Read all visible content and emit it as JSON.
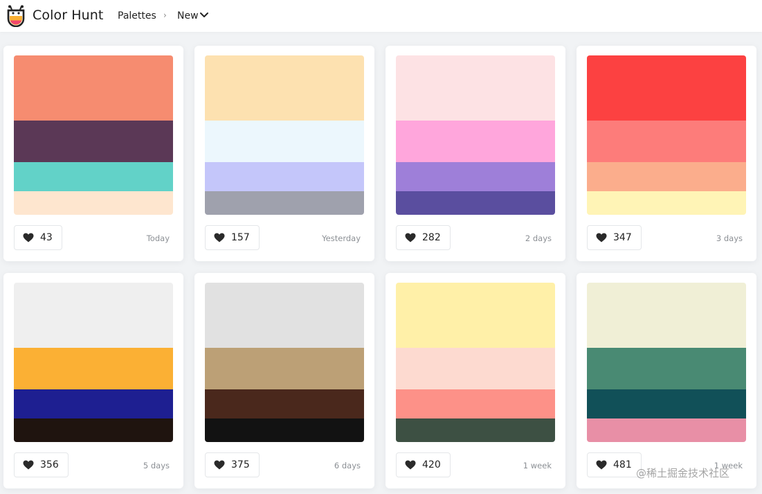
{
  "header": {
    "brand": "Color Hunt",
    "breadcrumb_palettes": "Palettes",
    "breadcrumb_sep": "›",
    "breadcrumb_new": "New"
  },
  "palettes": [
    {
      "colors": [
        "#f68c70",
        "#5b3856",
        "#62d2c8",
        "#fee6cf"
      ],
      "likes": "43",
      "date": "Today"
    },
    {
      "colors": [
        "#fde1b0",
        "#ecf7fd",
        "#c4c6fa",
        "#9fa1ad"
      ],
      "likes": "157",
      "date": "Yesterday"
    },
    {
      "colors": [
        "#fde2e4",
        "#ffa6dc",
        "#9e7fd9",
        "#5a4e9f"
      ],
      "likes": "282",
      "date": "2 days"
    },
    {
      "colors": [
        "#fc4141",
        "#fd7c7a",
        "#fbad8c",
        "#fff4b6"
      ],
      "likes": "347",
      "date": "3 days"
    },
    {
      "colors": [
        "#efefef",
        "#fbb034",
        "#1e1f91",
        "#1f140f"
      ],
      "likes": "356",
      "date": "5 days"
    },
    {
      "colors": [
        "#e1e1e1",
        "#bca076",
        "#4a281c",
        "#121212"
      ],
      "likes": "375",
      "date": "6 days"
    },
    {
      "colors": [
        "#fff0a8",
        "#fddad0",
        "#fd9188",
        "#3d5043"
      ],
      "likes": "420",
      "date": "1 week"
    },
    {
      "colors": [
        "#f0efd6",
        "#498a73",
        "#115058",
        "#e88fa6"
      ],
      "likes": "481",
      "date": "1 week"
    }
  ],
  "watermark": "@稀土掘金技术社区",
  "icons": {
    "logo": "color-hunt-logo",
    "like": "heart-icon",
    "dropdown": "chevron-down-icon"
  }
}
